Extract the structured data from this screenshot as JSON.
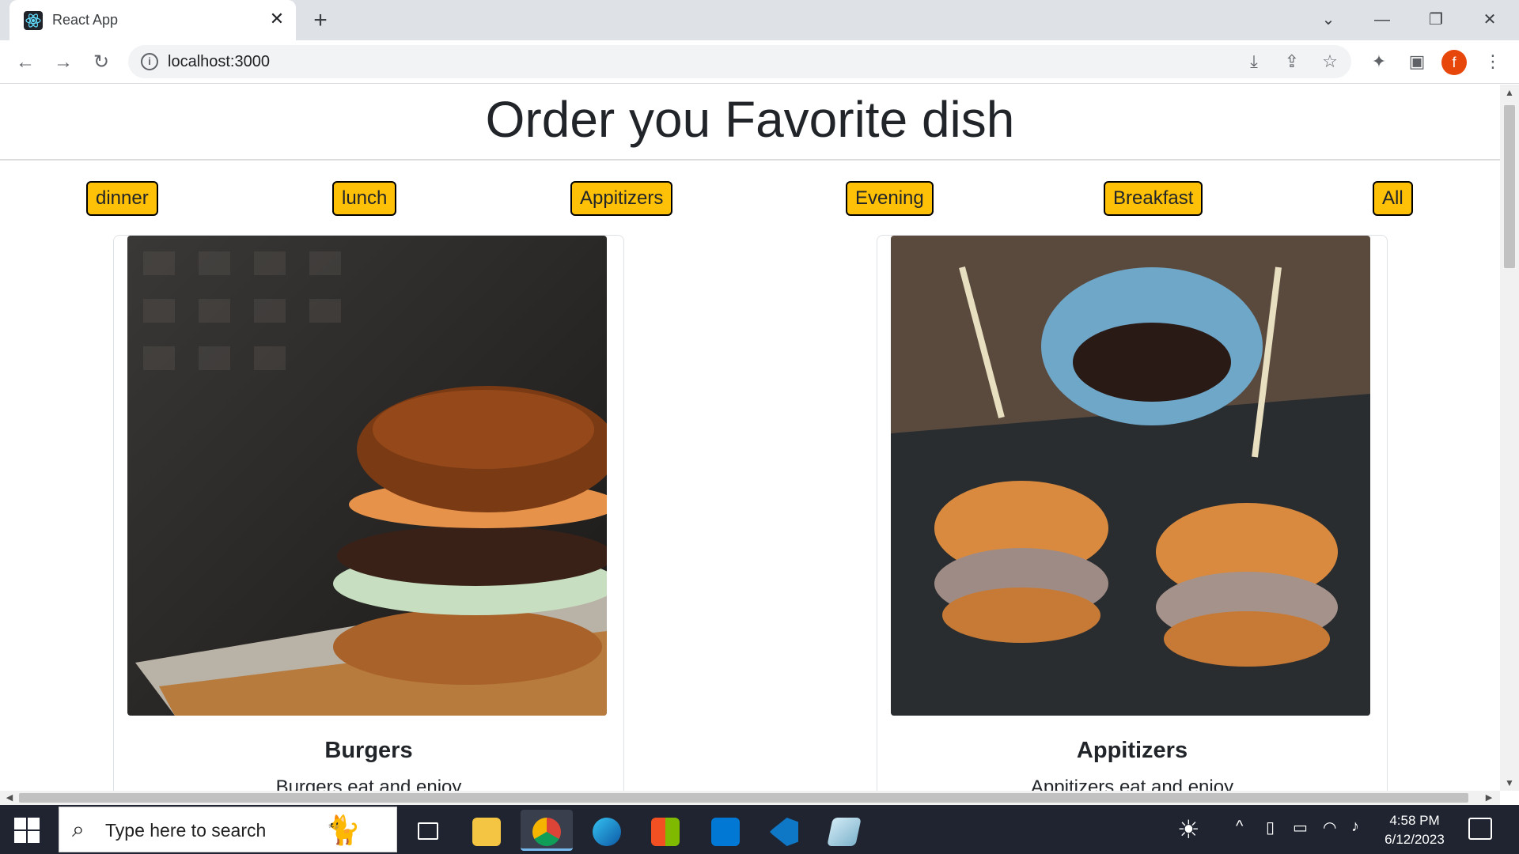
{
  "browser": {
    "tab_title": "React App",
    "url": "localhost:3000"
  },
  "page": {
    "title": "Order you Favorite dish",
    "categories": [
      "dinner",
      "lunch",
      "Appitizers",
      "Evening",
      "Breakfast",
      "All"
    ],
    "cards": [
      {
        "title": "Burgers",
        "text": "Burgers eat and enjoy"
      },
      {
        "title": "Appitizers",
        "text": "Appitizers eat and enjoy"
      }
    ]
  },
  "taskbar": {
    "search_placeholder": "Type here to search",
    "time": "4:58 PM",
    "date": "6/12/2023"
  },
  "icons": {
    "tab_favicon": "react-icon",
    "profile_initial": "f"
  },
  "colors": {
    "category_button": "#ffc107",
    "profile": "#e8470c"
  }
}
